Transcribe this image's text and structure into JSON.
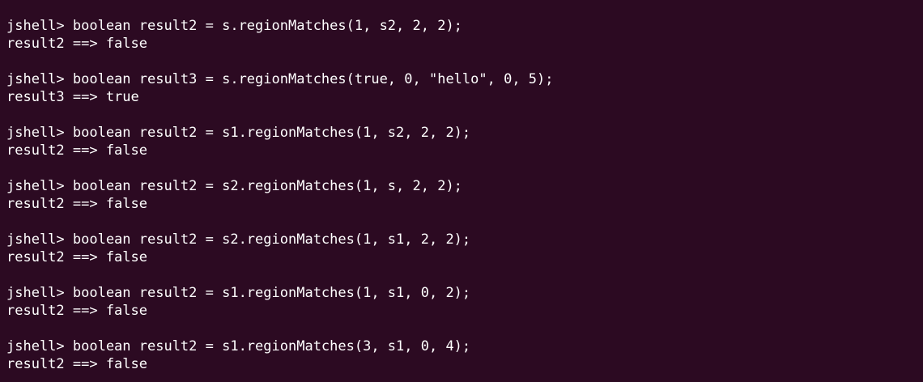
{
  "terminal": {
    "entries": [
      {
        "prompt": "jshell> boolean result2 = s.regionMatches(1, s2, 2, 2);",
        "output": "result2 ==> false"
      },
      {
        "prompt": "jshell> boolean result3 = s.regionMatches(true, 0, \"hello\", 0, 5);",
        "output": "result3 ==> true"
      },
      {
        "prompt": "jshell> boolean result2 = s1.regionMatches(1, s2, 2, 2);",
        "output": "result2 ==> false"
      },
      {
        "prompt": "jshell> boolean result2 = s2.regionMatches(1, s, 2, 2);",
        "output": "result2 ==> false"
      },
      {
        "prompt": "jshell> boolean result2 = s2.regionMatches(1, s1, 2, 2);",
        "output": "result2 ==> false"
      },
      {
        "prompt": "jshell> boolean result2 = s1.regionMatches(1, s1, 0, 2);",
        "output": "result2 ==> false"
      },
      {
        "prompt": "jshell> boolean result2 = s1.regionMatches(3, s1, 0, 4);",
        "output": "result2 ==> false"
      }
    ]
  }
}
